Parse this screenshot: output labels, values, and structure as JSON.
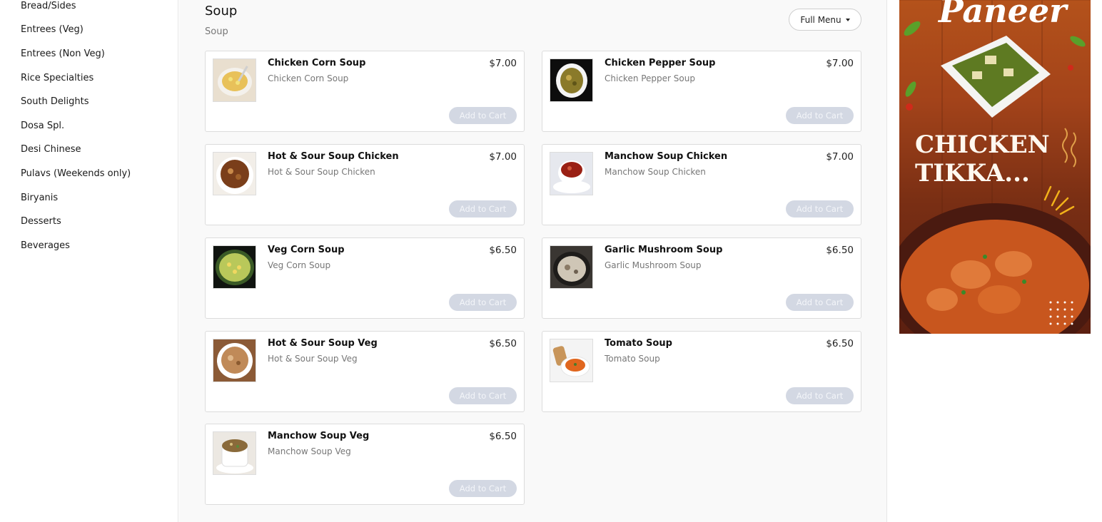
{
  "sidebar": {
    "items": [
      {
        "label": "Bread/Sides"
      },
      {
        "label": "Entrees (Veg)"
      },
      {
        "label": "Entrees (Non Veg)"
      },
      {
        "label": "Rice Specialties"
      },
      {
        "label": "South Delights"
      },
      {
        "label": "Dosa Spl."
      },
      {
        "label": "Desi Chinese"
      },
      {
        "label": "Pulavs (Weekends only)"
      },
      {
        "label": "Biryanis"
      },
      {
        "label": "Desserts"
      },
      {
        "label": "Beverages"
      }
    ]
  },
  "section": {
    "title": "Soup",
    "subtitle": "Soup",
    "menu_button": "Full Menu"
  },
  "items": [
    {
      "name": "Chicken Corn Soup",
      "desc": "Chicken Corn Soup",
      "price": "$7.00",
      "cart": "Add to Cart",
      "icon": "soup-bowl-icon"
    },
    {
      "name": "Chicken Pepper Soup",
      "desc": "Chicken Pepper Soup",
      "price": "$7.00",
      "cart": "Add to Cart",
      "icon": "soup-bowl-icon"
    },
    {
      "name": "Hot & Sour Soup Chicken",
      "desc": "Hot & Sour Soup Chicken",
      "price": "$7.00",
      "cart": "Add to Cart",
      "icon": "soup-bowl-icon"
    },
    {
      "name": "Manchow Soup Chicken",
      "desc": "Manchow Soup Chicken",
      "price": "$7.00",
      "cart": "Add to Cart",
      "icon": "soup-bowl-icon"
    },
    {
      "name": "Veg Corn Soup",
      "desc": "Veg Corn Soup",
      "price": "$6.50",
      "cart": "Add to Cart",
      "icon": "soup-bowl-icon"
    },
    {
      "name": "Garlic Mushroom Soup",
      "desc": "Garlic Mushroom Soup",
      "price": "$6.50",
      "cart": "Add to Cart",
      "icon": "soup-bowl-icon"
    },
    {
      "name": "Hot & Sour Soup Veg",
      "desc": "Hot & Sour Soup Veg",
      "price": "$6.50",
      "cart": "Add to Cart",
      "icon": "soup-bowl-icon"
    },
    {
      "name": "Tomato Soup",
      "desc": "Tomato Soup",
      "price": "$6.50",
      "cart": "Add to Cart",
      "icon": "soup-bowl-icon"
    },
    {
      "name": "Manchow Soup Veg",
      "desc": "Manchow Soup Veg",
      "price": "$6.50",
      "cart": "Add to Cart",
      "icon": "soup-bowl-icon"
    }
  ],
  "ad": {
    "headline_top": "Paneer",
    "headline_mid": "CHICKEN TIKKA...",
    "colors": {
      "background": "#a3431a",
      "text": "#ffffff"
    }
  },
  "colors": {
    "add_to_cart_disabled": "#d3d8e3",
    "main_background": "#f9f9f9"
  }
}
